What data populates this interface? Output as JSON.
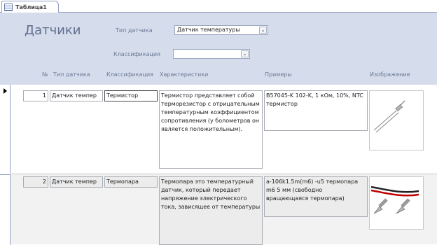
{
  "tab": {
    "title": "Таблица1"
  },
  "header": {
    "title": "Датчики",
    "sensor_type_label": "Тип датчика",
    "sensor_type_value": "Датчик температуры",
    "classification_label": "Классификация",
    "classification_value": ""
  },
  "columns": [
    "№",
    "Тип датчика",
    "Классификация",
    "Характеристики",
    "Примеры",
    "Изображение"
  ],
  "records": [
    {
      "num": "1",
      "type": "Датчик темпер",
      "classification": "Термистор",
      "characteristics": "Термистор представляет собой терморезистор с отрицательным температурным коэффициентом сопротивления (у болометров он является положительным).",
      "examples": "B57045-K 102-K, 1 кОм, 10%, NTC термистор",
      "image": "thermistor-image"
    },
    {
      "num": "2",
      "type": "Датчик темпер",
      "classification": "Термопара",
      "characteristics": "Термопара это температурный датчик, который передает напряжение электрического тока, зависящее от температуры",
      "examples": "a-106k1.5m(m6) -u5 термопара m6 5 мм (свободно вращающаяся термопара)",
      "image": "thermocouple-image"
    }
  ],
  "colors": {
    "header_bg": "#d5dceb",
    "row2_bg": "#f2f2f2",
    "title": "#60708f"
  }
}
